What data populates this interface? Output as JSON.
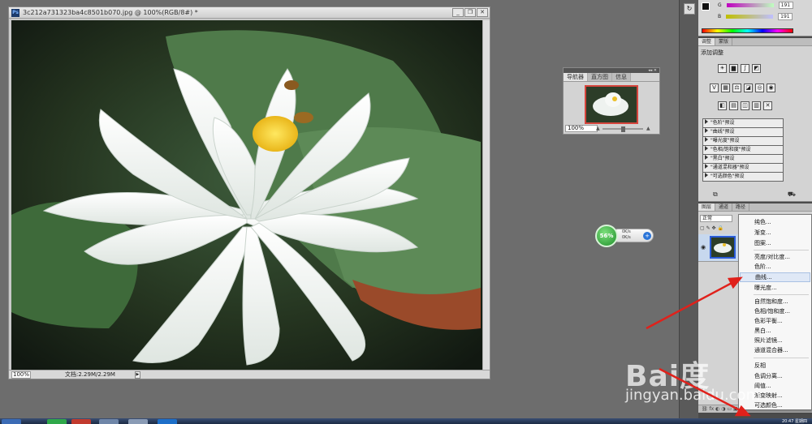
{
  "document": {
    "title": "3c212a731323ba4c8501b070.jpg @ 100%(RGB/8#) *",
    "app_badge": "Ps",
    "zoom": "100%",
    "doc_info": "文档:2.29M/2.29M",
    "minimize": "_",
    "restore": "❐",
    "close": "✕"
  },
  "navigator": {
    "tabs": [
      "导航器",
      "直方图",
      "信息"
    ],
    "zoom": "100%"
  },
  "net_widget": {
    "percent": "56%",
    "upload": "0K/s",
    "download": "0K/s",
    "plus": "+"
  },
  "color_panel": {
    "g_label": "G",
    "g_value": "191",
    "b_label": "B",
    "b_value": "191"
  },
  "adjust_panel": {
    "tabs": [
      "调整",
      "蒙版"
    ],
    "title": "添加调整",
    "presets": [
      "\"色阶\"预设",
      "\"曲线\"预设",
      "\"曝光度\"预设",
      "\"色相/饱和度\"预设",
      "\"黑白\"预设",
      "\"通道混和器\"预设",
      "\"可选颜色\"预设"
    ]
  },
  "layers_panel": {
    "tabs": [
      "图层",
      "通道",
      "路径"
    ],
    "blend_mode": "正常"
  },
  "context_menu": {
    "items": [
      "纯色...",
      "渐变...",
      "图案...",
      "亮度/对比度...",
      "色阶...",
      "曲线...",
      "曝光度...",
      "自然饱和度...",
      "色相/饱和度...",
      "色彩平衡...",
      "黑白...",
      "照片滤镜...",
      "通道混合器...",
      "反相",
      "色调分离...",
      "阈值...",
      "渐变映射...",
      "可选颜色..."
    ],
    "highlighted": "曲线..."
  },
  "watermark": {
    "logo": "Bai度",
    "url": "jingyan.baidu.com"
  },
  "taskbar": {
    "clock": "20:47 星期四"
  },
  "colors": {
    "workspace": "#6d6d6d",
    "annotation_arrow": "#e0211b",
    "menu_highlight": "#dfe8f6"
  }
}
